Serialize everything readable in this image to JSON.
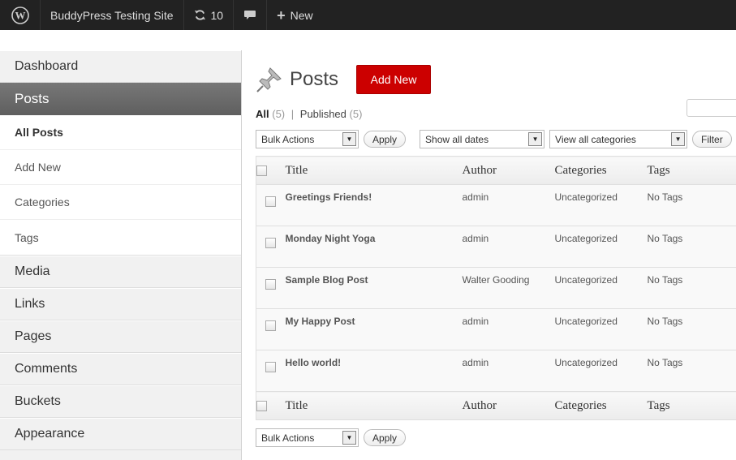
{
  "adminbar": {
    "site_name": "BuddyPress Testing Site",
    "updates_count": "10",
    "new_label": "New"
  },
  "sidebar": {
    "items": [
      {
        "label": "Dashboard"
      },
      {
        "label": "Posts"
      },
      {
        "label": "Media"
      },
      {
        "label": "Links"
      },
      {
        "label": "Pages"
      },
      {
        "label": "Comments"
      },
      {
        "label": "Buckets"
      },
      {
        "label": "Appearance"
      }
    ],
    "posts_submenu": [
      "All Posts",
      "Add New",
      "Categories",
      "Tags"
    ]
  },
  "page": {
    "title": "Posts",
    "add_new_label": "Add New",
    "filters": {
      "all_label": "All",
      "all_count": "(5)",
      "separator": "|",
      "published_label": "Published",
      "published_count": "(5)"
    },
    "bulk_actions": "Bulk Actions",
    "apply_label": "Apply",
    "dates_filter": "Show all dates",
    "categories_filter": "View all categories",
    "filter_label": "Filter"
  },
  "table": {
    "columns": [
      "Title",
      "Author",
      "Categories",
      "Tags"
    ],
    "rows": [
      {
        "title": "Greetings Friends!",
        "author": "admin",
        "categories": "Uncategorized",
        "tags": "No Tags"
      },
      {
        "title": "Monday Night Yoga",
        "author": "admin",
        "categories": "Uncategorized",
        "tags": "No Tags"
      },
      {
        "title": "Sample Blog Post",
        "author": "Walter Gooding",
        "categories": "Uncategorized",
        "tags": "No Tags"
      },
      {
        "title": "My Happy Post",
        "author": "admin",
        "categories": "Uncategorized",
        "tags": "No Tags"
      },
      {
        "title": "Hello world!",
        "author": "admin",
        "categories": "Uncategorized",
        "tags": "No Tags"
      }
    ]
  },
  "colors": {
    "adminbar_bg": "#222222",
    "add_new_bg": "#cc0000",
    "current_menu_bg": "#666666"
  }
}
